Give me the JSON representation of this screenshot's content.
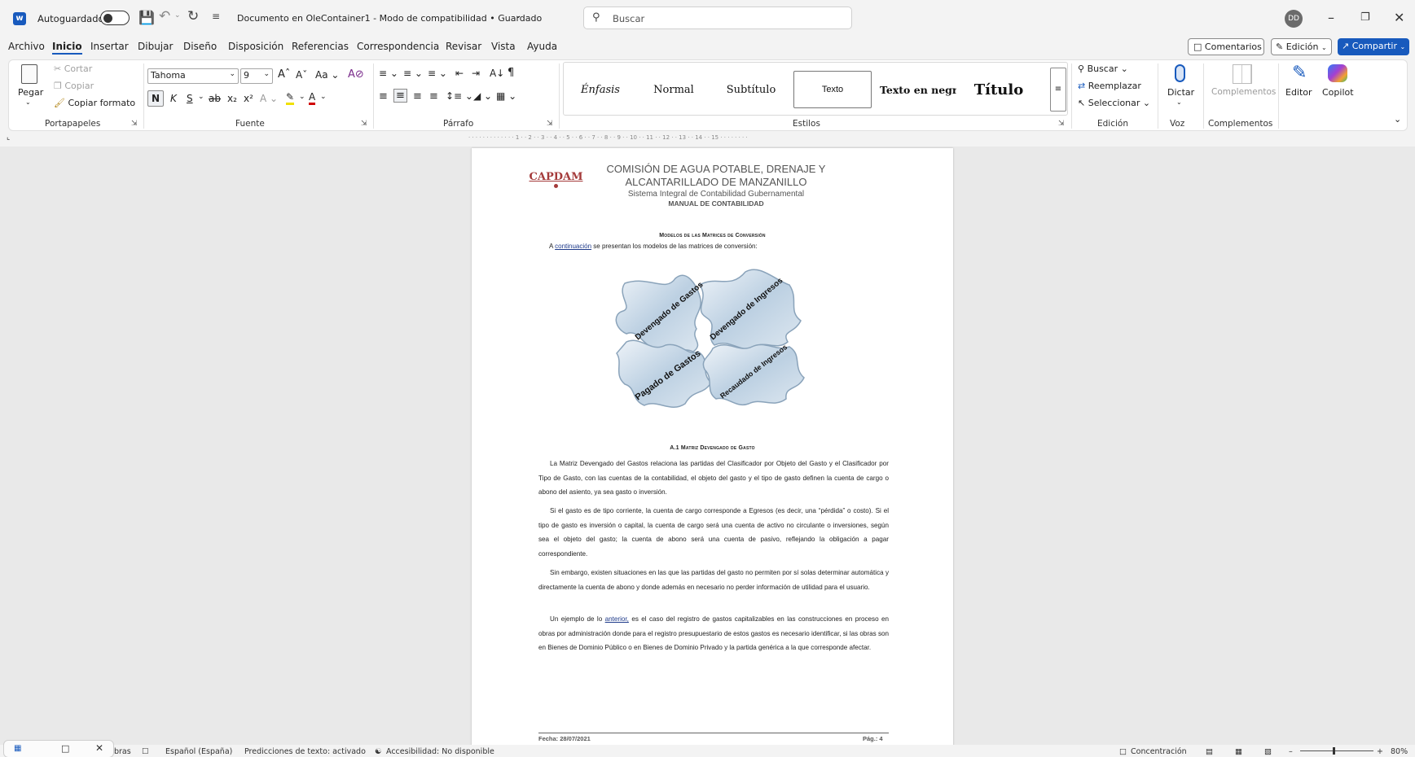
{
  "titlebar": {
    "autosave_label": "Autoguardado",
    "document_title": "Documento en OleContainer1  -  Modo de compatibilidad • Guardado",
    "search_placeholder": "Buscar",
    "user_initials": "DD"
  },
  "menu": {
    "items": [
      "Archivo",
      "Inicio",
      "Insertar",
      "Dibujar",
      "Diseño",
      "Disposición",
      "Referencias",
      "Correspondencia",
      "Revisar",
      "Vista",
      "Ayuda"
    ],
    "active": "Inicio",
    "comments_label": "Comentarios",
    "edit_label": "Edición",
    "share_label": "Compartir"
  },
  "ribbon": {
    "clipboard": {
      "paste": "Pegar",
      "cut": "Cortar",
      "copy": "Copiar",
      "format_painter": "Copiar formato",
      "label": "Portapapeles"
    },
    "font": {
      "name": "Tahoma",
      "size": "9",
      "label": "Fuente",
      "bold": "N",
      "italic": "K",
      "underline": "S",
      "change_case": "Aa"
    },
    "paragraph": {
      "label": "Párrafo"
    },
    "styles": {
      "items": [
        "Énfasis",
        "Normal",
        "Subtítulo",
        "Texto",
        "Texto en negri",
        "Título"
      ],
      "label": "Estilos"
    },
    "editing": {
      "find": "Buscar",
      "replace": "Reemplazar",
      "select": "Seleccionar",
      "label": "Edición"
    },
    "voice": {
      "dictate": "Dictar",
      "label": "Voz"
    },
    "addins": {
      "addins": "Complementos",
      "label": "Complementos"
    },
    "editor": {
      "editor": "Editor",
      "copilot": "Copilot"
    }
  },
  "ruler": {
    "text": "· · · · · · · · · · · · · 1 · · 2 · · 3 · · 4 · · 5 · · 6 · · 7 · · 8 · · 9 · · 10 · · 11 · · 12 · · 13 · · 14 · · 15 · · · · · · · ·"
  },
  "document": {
    "logo_text": "CAPDAM",
    "header_line1": "COMISIÓN DE AGUA POTABLE, DRENAJE Y",
    "header_line2": "ALCANTARILLADO DE MANZANILLO",
    "header_line3": "Sistema Integral de Contabilidad Gubernamental",
    "header_line4": "MANUAL DE CONTABILIDAD",
    "section_title": "Modelos de las Matrices de Conversión",
    "intro_a": "A ",
    "intro_link": "continuación",
    "intro_rest": " se presentan los modelos de las matrices de conversión:",
    "puzzle_labels": [
      "Devengado de Gastos",
      "Devengado de Ingresos",
      "Pagado de Gastos",
      "Recaudado de Ingresos"
    ],
    "subsection_title": "A.1 Matriz Devengado de Gasto",
    "p1": "La Matriz Devengado del Gastos relaciona las partidas del Clasificador por Objeto del Gasto y el Clasificador por Tipo de Gasto, con las cuentas de la contabilidad, el objeto del gasto y el tipo de gasto definen la cuenta de cargo o abono del asiento, ya sea gasto o inversión.",
    "p2": "Si el gasto es de tipo corriente, la cuenta de cargo corresponde a Egresos (es decir, una “pérdida” o costo). Si el tipo de gasto es inversión o capital, la cuenta de cargo será una cuenta de activo no circulante o inversiones, según sea el objeto del gasto; la cuenta de abono será una cuenta de pasivo, reflejando la obligación a pagar correspondiente.",
    "p3": "Sin embargo, existen situaciones en las que las partidas del gasto no permiten por sí solas determinar automática y directamente la cuenta de abono y donde además en necesario no perder información de utilidad para el usuario.",
    "p4_a": "Un ejemplo de lo ",
    "p4_link": "anterior,",
    "p4_rest": " es el caso del registro de gastos capitalizables en las construcciones en proceso en obras por administración donde para el registro presupuestario de estos gastos es necesario identificar, si las obras son en Bienes de Dominio Público o en Bienes de Dominio Privado y la partida genérica a la que corresponde afectar.",
    "footer_date": "Fecha: 28/07/2021",
    "footer_page": "Pág.: 4"
  },
  "statusbar": {
    "words": "bras",
    "language": "Español (España)",
    "predictions": "Predicciones de texto: activado",
    "accessibility": "Accesibilidad: No disponible",
    "focus": "Concentración",
    "zoom": "80%"
  },
  "colors": {
    "accent": "#185abd",
    "logo": "#a43a3a",
    "page": "#ffffff",
    "canvas": "#e9e9e9"
  }
}
